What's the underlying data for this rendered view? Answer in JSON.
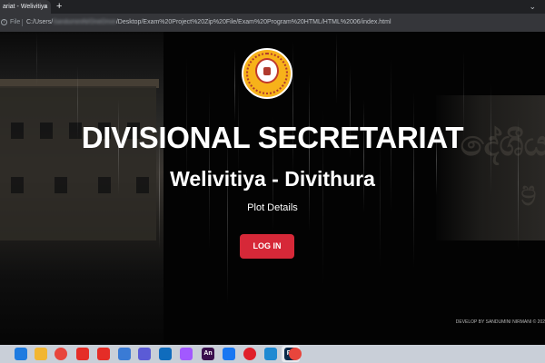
{
  "browser": {
    "tab_title": "ariat - Welivitiya",
    "close_glyph": "×",
    "new_tab_glyph": "+",
    "tab_menu_glyph": "⌄",
    "scheme_label": "File",
    "url_prefix": "C:/Users/",
    "url_redacted": "SanduminiN/OneDrive",
    "url_rest": "/Desktop/Exam%20Project%20Zip%20File/Exam%20Program%20HTML/HTML%2006/index.html"
  },
  "page": {
    "title": "DIVISIONAL SECRETARIAT",
    "subtitle": "Welivitiya - Divithura",
    "section": "Plot Details",
    "login_label": "LOG IN",
    "footer": "DEVELOP BY SANDUMINI NIRMANI © 202",
    "logo_icon": "divisional-secretariat-seal",
    "accent_color": "#d62838",
    "logo_color": "#f7b21a"
  },
  "taskbar": {
    "apps": [
      {
        "icon": "windows-icon",
        "label": ""
      },
      {
        "icon": "file-explorer-icon",
        "label": ""
      },
      {
        "icon": "chrome-icon",
        "label": ""
      },
      {
        "icon": "youtube-icon",
        "label": ""
      },
      {
        "icon": "youtube-icon",
        "label": ""
      },
      {
        "icon": "files-icon",
        "label": ""
      },
      {
        "icon": "media-player-icon",
        "label": ""
      },
      {
        "icon": "outlook-icon",
        "label": ""
      },
      {
        "icon": "figma-icon",
        "label": ""
      },
      {
        "icon": "animate-icon",
        "label": "An"
      },
      {
        "icon": "facebook-icon",
        "label": ""
      },
      {
        "icon": "opera-icon",
        "label": ""
      },
      {
        "icon": "vscode-icon",
        "label": ""
      },
      {
        "icon": "photoshop-icon",
        "label": "Ps"
      },
      {
        "icon": "chrome-active-icon",
        "label": ""
      }
    ]
  }
}
